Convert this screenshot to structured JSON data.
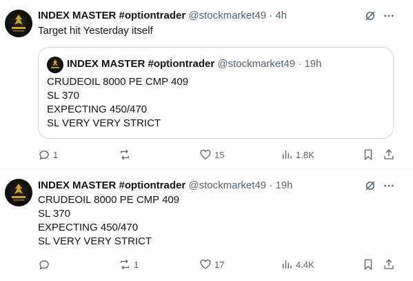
{
  "colors": {
    "text": "#0f1419",
    "secondary": "#536471",
    "border": "#cfd9de",
    "logo_gold": "#c9a227"
  },
  "tweets": [
    {
      "name": "INDEX MASTER #optiontrader",
      "handle": "@stockmarket49",
      "dot": "·",
      "time": "4h",
      "text": "Target hit Yesterday itself",
      "quote": {
        "name": "INDEX MASTER #optiontrader",
        "handle": "@stockmarket49",
        "dot": "·",
        "time": "19h",
        "lines": [
          "CRUDEOIL 8000 PE CMP 409",
          "SL 370",
          "EXPECTING 450/470",
          "SL VERY VERY STRICT"
        ]
      },
      "actions": {
        "replies": "1",
        "reposts": "",
        "likes": "15",
        "views": "1.8K"
      }
    },
    {
      "name": "INDEX MASTER #optiontrader",
      "handle": "@stockmarket49",
      "dot": "·",
      "time": "19h",
      "lines": [
        "CRUDEOIL 8000 PE CMP 409",
        "SL 370",
        "EXPECTING 450/470",
        "SL VERY VERY STRICT"
      ],
      "actions": {
        "replies": "",
        "reposts": "1",
        "likes": "17",
        "views": "4.4K"
      }
    }
  ],
  "icons": [
    "grok-icon",
    "more-icon",
    "reply-icon",
    "repost-icon",
    "like-icon",
    "views-icon",
    "bookmark-icon",
    "share-icon"
  ]
}
